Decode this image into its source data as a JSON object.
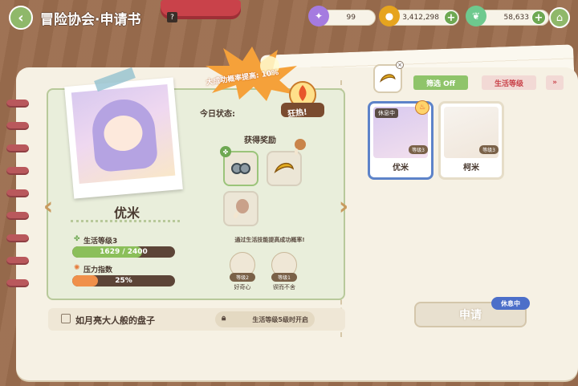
{
  "header": {
    "title": "冒险协会·申请书",
    "help_icon": "?"
  },
  "currencies": [
    {
      "name": "purple-gem",
      "value": "99",
      "color": "#a57be0"
    },
    {
      "name": "gold-coin",
      "value": "3,412,298",
      "color": "#e6a41e"
    },
    {
      "name": "leaf",
      "value": "58,633",
      "color": "#6ec98e"
    }
  ],
  "status": {
    "today_label": "今日状态:",
    "burst_text": "大成功概率提高: 10%",
    "frenzy_label": "狂热!"
  },
  "rewards": {
    "title": "获得奖励",
    "hint": "通过生活技能提高成功概率!"
  },
  "character": {
    "name": "优米",
    "life_level_label": "生活等级3",
    "exp_text": "1629 / 2400",
    "exp_fraction": 0.68,
    "stress_label": "压力指数",
    "stress_text": "25%",
    "stress_fraction": 0.25
  },
  "traits": [
    {
      "badge": "等级2",
      "name": "好奇心"
    },
    {
      "badge": "等级1",
      "name": "锲而不舍"
    }
  ],
  "quest": {
    "title": "如月亮大人般的盘子",
    "lock_text": "生活等级5级时开启"
  },
  "filters": {
    "filter_label": "筛选 Off",
    "sort_label": "生活等级",
    "collapse_icon": "»"
  },
  "roster": [
    {
      "name": "优米",
      "level": "等级3",
      "tag": "休息中",
      "selected": true
    },
    {
      "name": "柯米",
      "level": "等级3",
      "tag": "",
      "selected": false
    }
  ],
  "apply": {
    "label": "申请",
    "resting_badge": "休息中"
  },
  "colors": {
    "accent_green": "#8fb86a",
    "exp_bar": "#8bbf5a",
    "stress_bar": "#f0904a",
    "select_blue": "#5d83c9"
  }
}
